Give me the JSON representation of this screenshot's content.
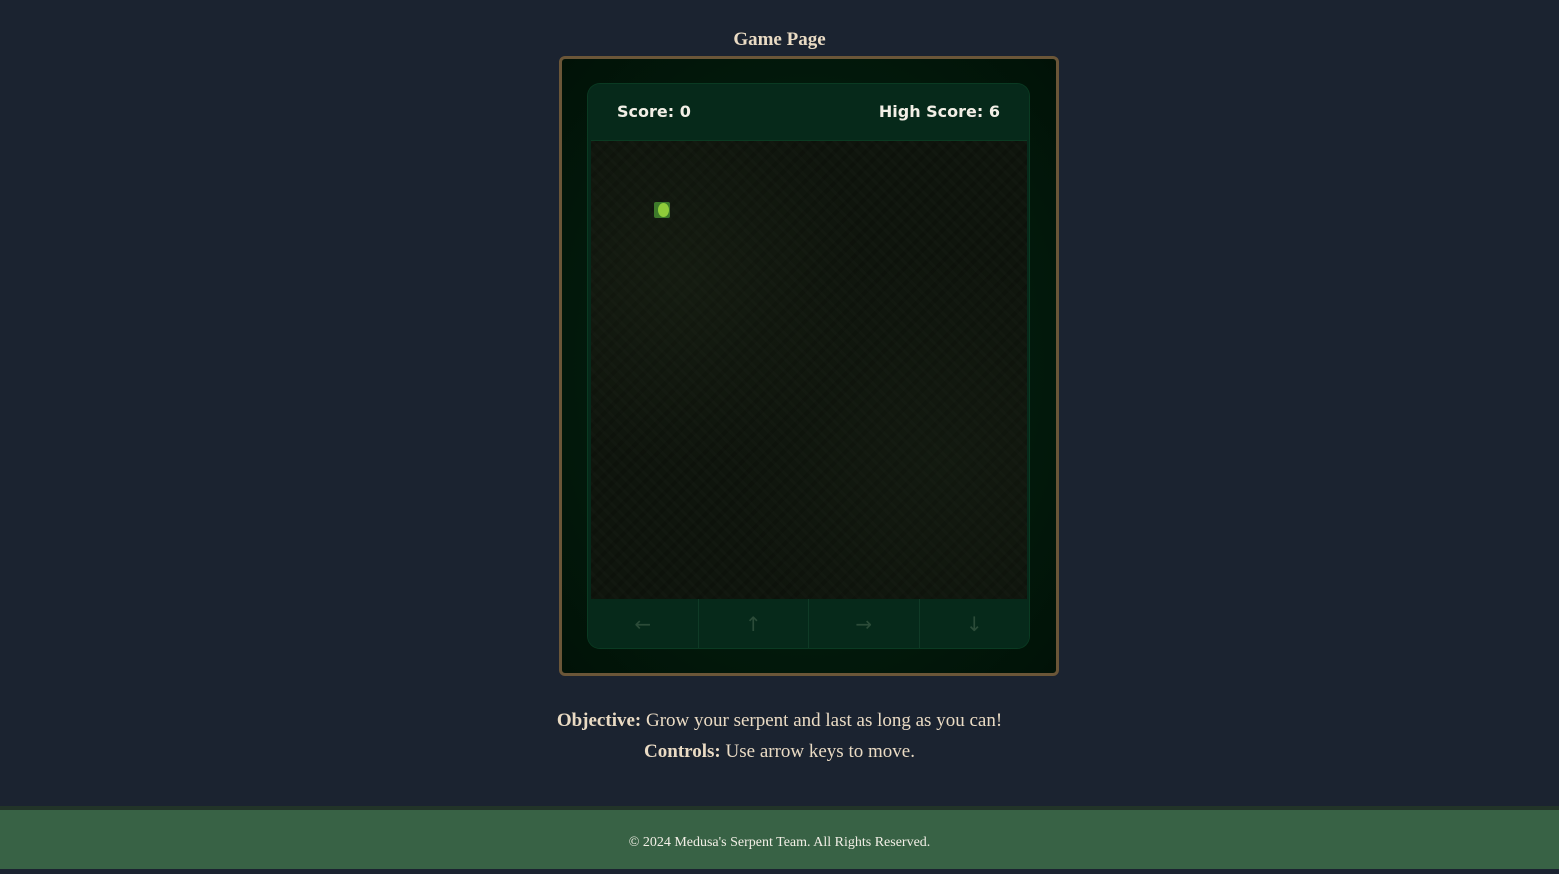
{
  "page": {
    "title": "Game Page"
  },
  "game": {
    "score_label": "Score: 0",
    "high_score_label": "High Score: 6",
    "controls": {
      "left": "←",
      "up": "↑",
      "right": "→",
      "down": "↓"
    }
  },
  "info": {
    "objective_label": "Objective:",
    "objective_text": " Grow your serpent and last as long as you can!",
    "controls_label": "Controls:",
    "controls_text": " Use arrow keys to move."
  },
  "footer": {
    "copyright": "© 2024 Medusa's Serpent Team. All Rights Reserved."
  },
  "colors": {
    "background": "#1b2330",
    "frame_border": "#6b5638",
    "console": "#06291a",
    "board": "#0f150d",
    "snake": "#8fcc3a",
    "footer": "#386245"
  }
}
